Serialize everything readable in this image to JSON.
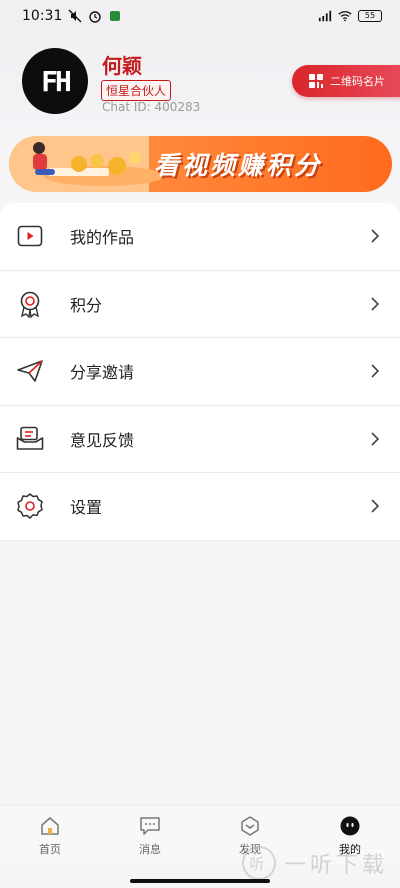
{
  "status_bar": {
    "time": "10:31",
    "battery": "55"
  },
  "profile": {
    "name": "何颖",
    "badge": "恒星合伙人",
    "chat_id": "Chat ID: 400283",
    "avatar_text": "FH",
    "qr_button_label": "二维码名片"
  },
  "banner": {
    "text": "看视频赚积分"
  },
  "menu": {
    "items": [
      {
        "label": "我的作品",
        "icon": "video-play-icon"
      },
      {
        "label": "积分",
        "icon": "medal-icon"
      },
      {
        "label": "分享邀请",
        "icon": "paper-plane-icon"
      },
      {
        "label": "意见反馈",
        "icon": "feedback-box-icon"
      },
      {
        "label": "设置",
        "icon": "gear-icon"
      }
    ]
  },
  "tabbar": {
    "tabs": [
      {
        "label": "首页",
        "icon": "home-icon"
      },
      {
        "label": "消息",
        "icon": "chat-bubble-icon"
      },
      {
        "label": "发现",
        "icon": "discover-icon"
      },
      {
        "label": "我的",
        "icon": "profile-face-icon"
      }
    ],
    "active_index": 3
  },
  "watermark": "一听下载",
  "colors": {
    "brand_red": "#c41c1c",
    "banner_orange": "#ff7a2e"
  }
}
